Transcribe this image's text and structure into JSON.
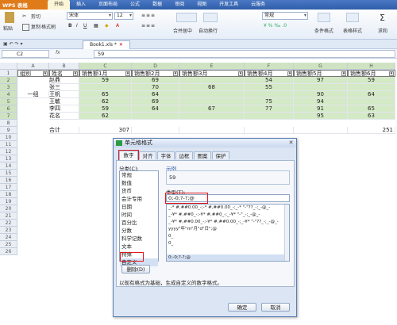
{
  "app": {
    "name": "WPS 表格"
  },
  "ribbon_tabs": [
    "开始",
    "插入",
    "页面布局",
    "公式",
    "数据",
    "审阅",
    "视图",
    "开发工具",
    "云服务"
  ],
  "ribbon": {
    "paste": "粘贴",
    "cut": "剪切",
    "copy": "复制",
    "format_painter": "格式刷",
    "font": "宋体",
    "size": "12",
    "merge": "合并居中",
    "wrap": "自动换行",
    "numfmt": "常规",
    "cond_format": "条件格式",
    "table_style": "表格样式",
    "sum_fn": "求和"
  },
  "doc_tab": {
    "name": "Book1.xls *"
  },
  "formula_bar": {
    "cell_ref": "C2",
    "fx": "fx",
    "value": "59"
  },
  "columns": [
    "A",
    "B",
    "C",
    "D",
    "E",
    "F",
    "G",
    "H"
  ],
  "rows": [
    "1",
    "2",
    "3",
    "4",
    "5",
    "6",
    "7",
    "8",
    "9",
    "10",
    "11",
    "12",
    "13",
    "14",
    "15",
    "16",
    "17",
    "18",
    "19",
    "20",
    "21",
    "22",
    "23",
    "24",
    "25",
    "26"
  ],
  "sheet": {
    "header": [
      "组别",
      "姓名",
      "销售额1月",
      "销售额2月",
      "销售额3月",
      "销售额4月",
      "销售额5月",
      "销售额6月"
    ],
    "group_label": "一组",
    "names": [
      "赵鼎",
      "张三",
      "王帆",
      "王敏",
      "李四",
      "花名"
    ],
    "data": [
      [
        "59",
        "69",
        "",
        "54",
        "97",
        "59"
      ],
      [
        "",
        "70",
        "68",
        "55",
        "",
        ""
      ],
      [
        "65",
        "64",
        "",
        "",
        "90",
        "64"
      ],
      [
        "62",
        "69",
        "",
        "75",
        "94",
        ""
      ],
      [
        "59",
        "64",
        "67",
        "77",
        "91",
        "65"
      ],
      [
        "62",
        "",
        "",
        "",
        "95",
        "63"
      ]
    ],
    "total_label": "合计",
    "totals": [
      "307",
      "",
      "",
      "",
      "",
      "251"
    ]
  },
  "dialog": {
    "title": "单元格格式",
    "tabs": [
      "数字",
      "对齐",
      "字体",
      "边框",
      "图案",
      "保护"
    ],
    "category_label": "分类(C):",
    "categories": [
      "常规",
      "数值",
      "货币",
      "会计专用",
      "日期",
      "时间",
      "百分比",
      "分数",
      "科学记数",
      "文本",
      "特殊",
      "自定义"
    ],
    "sample_label": "示例",
    "sample_value": "59",
    "type_label": "类型(T):",
    "type_value": "0;-0;?-?;@",
    "formats": [
      "_-* #,##0.00_-;-* #,##0.00_-;_-* \"-\"??_-;_-@_-",
      "_-¥* #,##0_-;-¥* #,##0_-;_-¥* \"-\"_-;_-@_-",
      "_-¥* #,##0.00_-;-¥* #,##0.00_-;_-¥* \"-\"??_-;_-@_-",
      "yyyy\"年\"m\"月\"d\"日\";@",
      "0_",
      "0_ ",
      "",
      "0;-0;?-?;@"
    ],
    "delete_label": "删除(D)",
    "description": "以现有格式为基础，生成自定义的数字格式。",
    "ok_label": "确定",
    "cancel_label": "取消"
  },
  "colors": {
    "accent": "#2f5ea8",
    "highlight": "#d4e9c6",
    "callout": "#e0181e"
  }
}
